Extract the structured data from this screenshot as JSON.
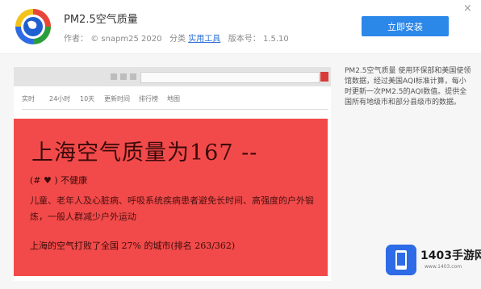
{
  "app": {
    "title": "PM2.5空气质量",
    "author_label": "作者：",
    "author": "© snapm25 2020",
    "category_label": "分类",
    "category": "实用工具",
    "version_label": "版本号：",
    "version": "1.5.10",
    "install_label": "立即安装",
    "close_label": "×"
  },
  "description": "PM2.5空气质量 使用环保部和美国使领馆数据，经过美国AQI标准计算，每小时更新一次PM2.5的AQI数值。提供全国所有地级市和部分县级市的数据。",
  "screenshot": {
    "nav": [
      "实时",
      "24小时",
      "10天",
      "更新时间",
      "排行榜",
      "地图"
    ],
    "headline": "上海空气质量为167 --",
    "status": "(# ♥ ) 不健康",
    "advice": "儿童、老年人及心脏病、呼吸系统疾病患者避免长时间、高强度的户外锻炼，一般人群减少户外运动",
    "rank": "上海的空气打败了全国 27% 的城市(排名 263/362)"
  },
  "watermark": {
    "text": "1403手游网",
    "url": "www.1403.com"
  },
  "colors": {
    "install_button": "#2b87e8",
    "aqi_panel": "#f24a4a"
  },
  "icons": {
    "app": "globe-with-ring-icon",
    "watermark": "phone-icon"
  }
}
